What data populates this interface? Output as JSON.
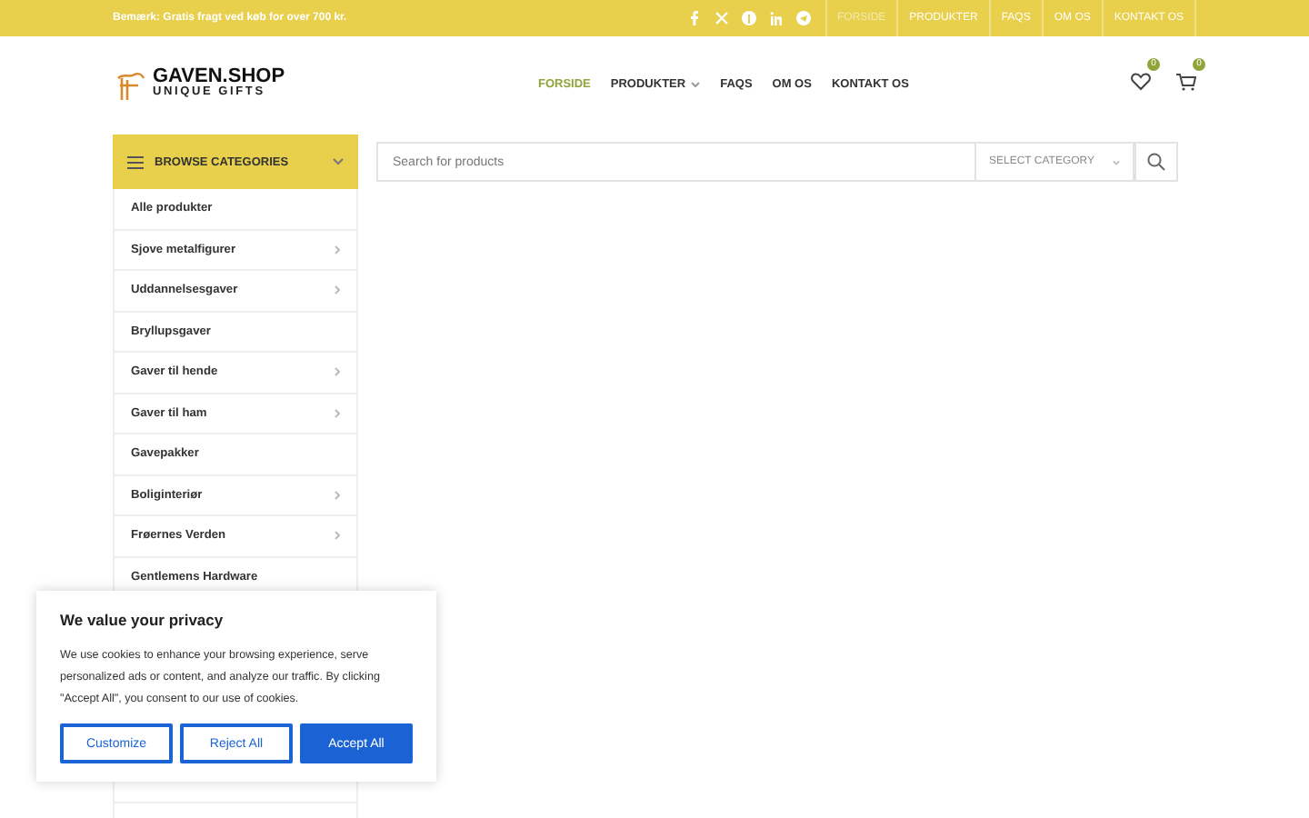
{
  "top_bar": {
    "notice": "Bemærk: Gratis fragt ved køb for over 700 kr.",
    "links": [
      {
        "label": "FORSIDE",
        "selected": true
      },
      {
        "label": "PRODUKTER",
        "selected": false
      },
      {
        "label": "FAQS",
        "selected": false
      },
      {
        "label": "OM OS",
        "selected": false
      },
      {
        "label": "KONTAKT OS",
        "selected": false
      }
    ]
  },
  "header": {
    "logo_title": "GAVEN.SHOP",
    "logo_subtitle": "UNIQUE GIFTS",
    "nav": [
      {
        "label": "FORSIDE",
        "selected": true,
        "has_submenu": false
      },
      {
        "label": "PRODUKTER",
        "selected": false,
        "has_submenu": true
      },
      {
        "label": "FAQS",
        "selected": false,
        "has_submenu": false
      },
      {
        "label": "OM OS",
        "selected": false,
        "has_submenu": false
      },
      {
        "label": "KONTAKT OS",
        "selected": false,
        "has_submenu": false
      }
    ],
    "wishlist_count": "0",
    "cart_count": "0"
  },
  "categories": {
    "title": "BROWSE CATEGORIES",
    "items": [
      {
        "label": "Alle produkter",
        "has_submenu": false
      },
      {
        "label": "Sjove metalfigurer",
        "has_submenu": true
      },
      {
        "label": "Uddannelsesgaver",
        "has_submenu": true
      },
      {
        "label": "Bryllupsgaver",
        "has_submenu": false
      },
      {
        "label": "Gaver til hende",
        "has_submenu": true
      },
      {
        "label": "Gaver til ham",
        "has_submenu": true
      },
      {
        "label": "Gavepakker",
        "has_submenu": false
      },
      {
        "label": "Boliginteriør",
        "has_submenu": true
      },
      {
        "label": "Frøernes Verden",
        "has_submenu": true
      },
      {
        "label": "Gentlemens Hardware",
        "has_submenu": false
      }
    ]
  },
  "search": {
    "placeholder": "Search for products",
    "category": "SELECT CATEGORY"
  },
  "cookie_banner": {
    "title": "We value your privacy",
    "text": "We use cookies to enhance your browsing experience, serve personalized ads or content, and analyze our traffic. By clicking \"Accept All\", you consent to our use of cookies.",
    "buttons": [
      {
        "label": "Customize",
        "kind": "outline"
      },
      {
        "label": "Reject All",
        "kind": "outline"
      },
      {
        "label": "Accept All",
        "kind": "primary"
      }
    ]
  }
}
